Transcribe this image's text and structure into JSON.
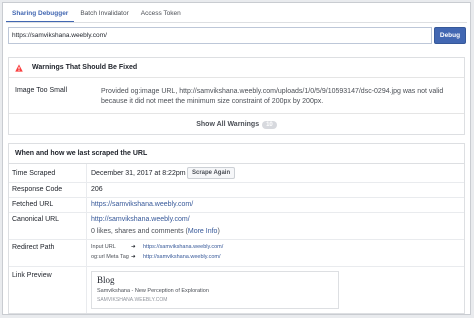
{
  "tabs": [
    {
      "label": "Sharing Debugger"
    },
    {
      "label": "Batch Invalidator"
    },
    {
      "label": "Access Token"
    }
  ],
  "search": {
    "url_value": "https://samvikshana.weebly.com/",
    "button_label": "Debug"
  },
  "warnings": {
    "title": "Warnings That Should Be Fixed",
    "item_label": "Image Too Small",
    "item_text": "Provided og:image URL, http://samvikshana.weebly.com/uploads/1/0/5/9/10593147/dsc-0294.jpg was not valid because it did not meet the minimum size constraint of 200px by 200px.",
    "show_all_label": "Show All Warnings",
    "count": "10"
  },
  "scrape": {
    "title": "When and how we last scraped the URL",
    "time_label": "Time Scraped",
    "time_value": "December 31, 2017 at 8:22pm",
    "scrape_again": "Scrape Again",
    "response_label": "Response Code",
    "response_value": "206",
    "fetched_label": "Fetched URL",
    "fetched_value": "https://samvikshana.weebly.com/",
    "canonical_label": "Canonical URL",
    "canonical_value": "http://samvikshana.weebly.com/",
    "likes_prefix": "0 likes, shares and comments (",
    "more_info": "More Info",
    "likes_suffix": ")",
    "redirect_label": "Redirect Path",
    "redirect_rows": [
      {
        "key": "Input URL",
        "value": "https://samvikshana.weebly.com/"
      },
      {
        "key": "og:url Meta Tag",
        "value": "http://samvikshana.weebly.com/"
      }
    ],
    "preview_label": "Link Preview",
    "preview": {
      "title": "Blog",
      "description": "Samvikshana - New Perception of Exploration",
      "domain": "SAMVIKSHANA.WEEBLY.COM"
    }
  },
  "colors": {
    "accent": "#4267b2",
    "warning": "#fa3e3e",
    "link": "#365899"
  },
  "icons": {
    "warning": "warning-triangle-icon",
    "redirect_arrow": "arrow-right-icon"
  }
}
